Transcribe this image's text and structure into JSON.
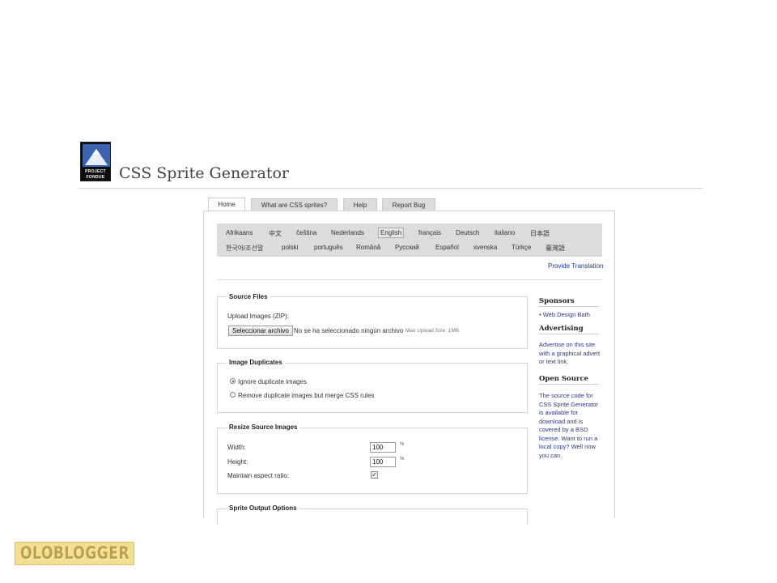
{
  "site": {
    "title": "CSS Sprite Generator",
    "logo_line1": "PROJECT",
    "logo_line2": "FONDUE"
  },
  "tabs": [
    {
      "label": "Home",
      "active": true
    },
    {
      "label": "What are CSS sprites?",
      "active": false
    },
    {
      "label": "Help",
      "active": false
    },
    {
      "label": "Report Bug",
      "active": false
    }
  ],
  "languages": {
    "row1": [
      "Afrikaans",
      "中文",
      "čeština",
      "Nederlands",
      "English",
      "français",
      "Deutsch",
      "italiano",
      "日本語"
    ],
    "row2": [
      "한국어/조선말",
      "polski",
      "português",
      "Română",
      "Русский",
      "Español",
      "svenska",
      "Türkçe",
      "臺灣語"
    ],
    "selected": "English"
  },
  "provide_translation": "Provide Translation",
  "source_files": {
    "legend": "Source Files",
    "upload_label": "Upload Images (ZIP):",
    "button_label": "Seleccionar archivo",
    "no_file_text": "No se ha seleccionado ningún archivo",
    "max_size": "Max Upload Size: 1MB"
  },
  "image_duplicates": {
    "legend": "Image Duplicates",
    "option_ignore": "Ignore duplicate images",
    "option_merge": "Remove duplicate images but merge CSS rules",
    "selected": "ignore"
  },
  "resize": {
    "legend": "Resize Source Images",
    "width_label": "Width:",
    "width_value": "100",
    "height_label": "Height:",
    "height_value": "100",
    "unit": "%",
    "aspect_label": "Maintain aspect ratio:",
    "aspect_checked": true,
    "check_glyph": "✓"
  },
  "sprite_output": {
    "legend": "Sprite Output Options"
  },
  "sidebar": {
    "sponsors_heading": "Sponsors",
    "sponsors": [
      "Web Design Bath"
    ],
    "advertising_heading": "Advertising",
    "advertising_text": "Advertise on this site with a graphical advert or text link.",
    "open_source_heading": "Open Source",
    "open_source_text": "The source code for CSS Sprite Generator is available for download and is covered by a BSD license. Want to run a local copy? Well now you can."
  },
  "watermark": "OLOBLOGGER",
  "colors": {
    "link": "#1a3a8a",
    "lang_bar": "#dcdcdc",
    "watermark_bg": "#f1df92",
    "watermark_text": "#bfa04a"
  }
}
